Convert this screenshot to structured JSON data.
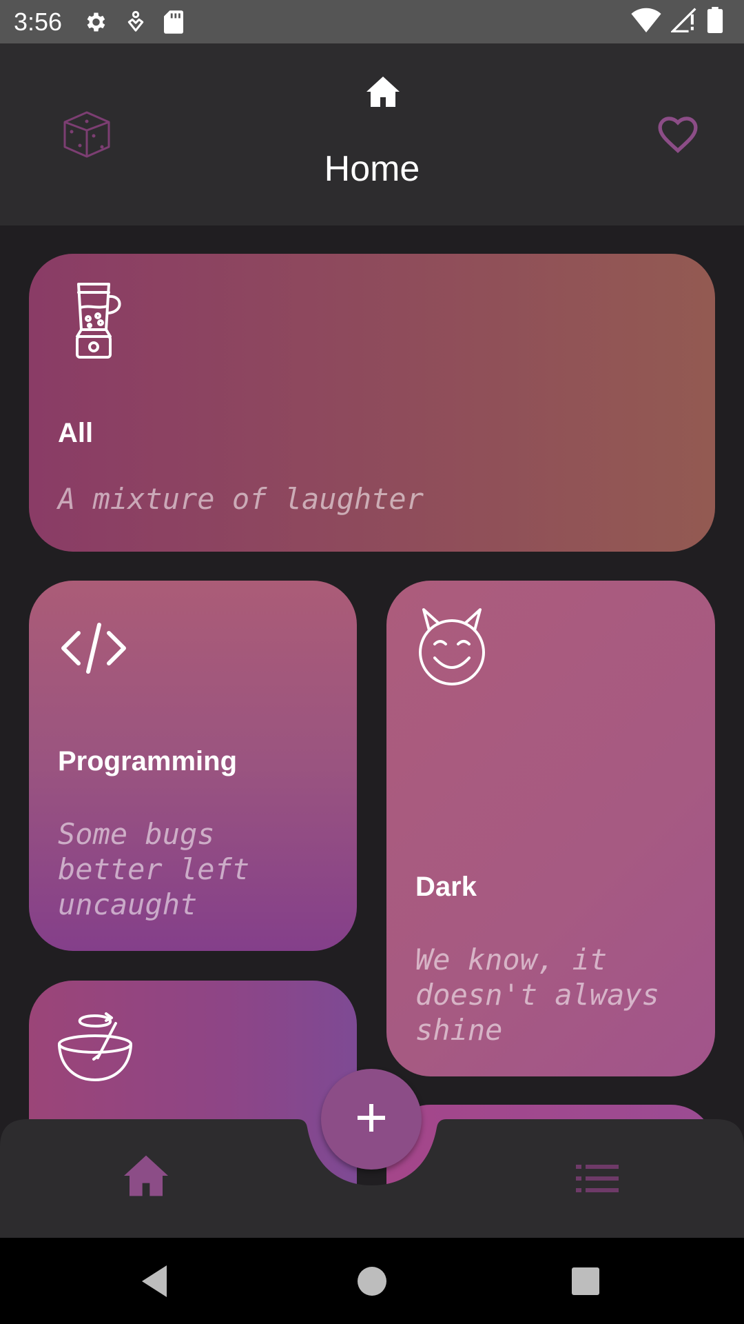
{
  "status_bar": {
    "time": "3:56",
    "left_icons": [
      "gear-icon",
      "wellbeing-icon",
      "sd-card-icon"
    ],
    "right_icons": [
      "wifi-icon",
      "signal-icon",
      "battery-icon"
    ]
  },
  "header": {
    "title": "Home",
    "icons": [
      "home-icon",
      "dice-icon",
      "heart-icon"
    ]
  },
  "categories": [
    {
      "label": "All",
      "description": "A mixture of laughter",
      "icon": "blender-icon"
    },
    {
      "label": "Programming",
      "description_lines": [
        "Some bugs",
        "better left",
        "uncaught"
      ],
      "icon": "code-icon"
    },
    {
      "label": "Dark",
      "description_lines": [
        "We know, it",
        "doesn't always",
        "shine"
      ],
      "icon": "devil-face-icon"
    },
    {
      "label": "",
      "icon": "mixing-bowl-icon"
    }
  ],
  "fab": {
    "icon": "plus-icon"
  },
  "bottom_nav": {
    "items": [
      {
        "name": "home",
        "icon": "home-icon",
        "active": true
      },
      {
        "name": "list",
        "icon": "list-icon",
        "active": false
      }
    ]
  },
  "system_nav": [
    "back-icon",
    "home-circle-icon",
    "recents-icon"
  ],
  "colors": {
    "accent": "#8c4d87",
    "background": "#201e21",
    "app_bar": "#2d2c2e",
    "status_bar": "#555555"
  }
}
